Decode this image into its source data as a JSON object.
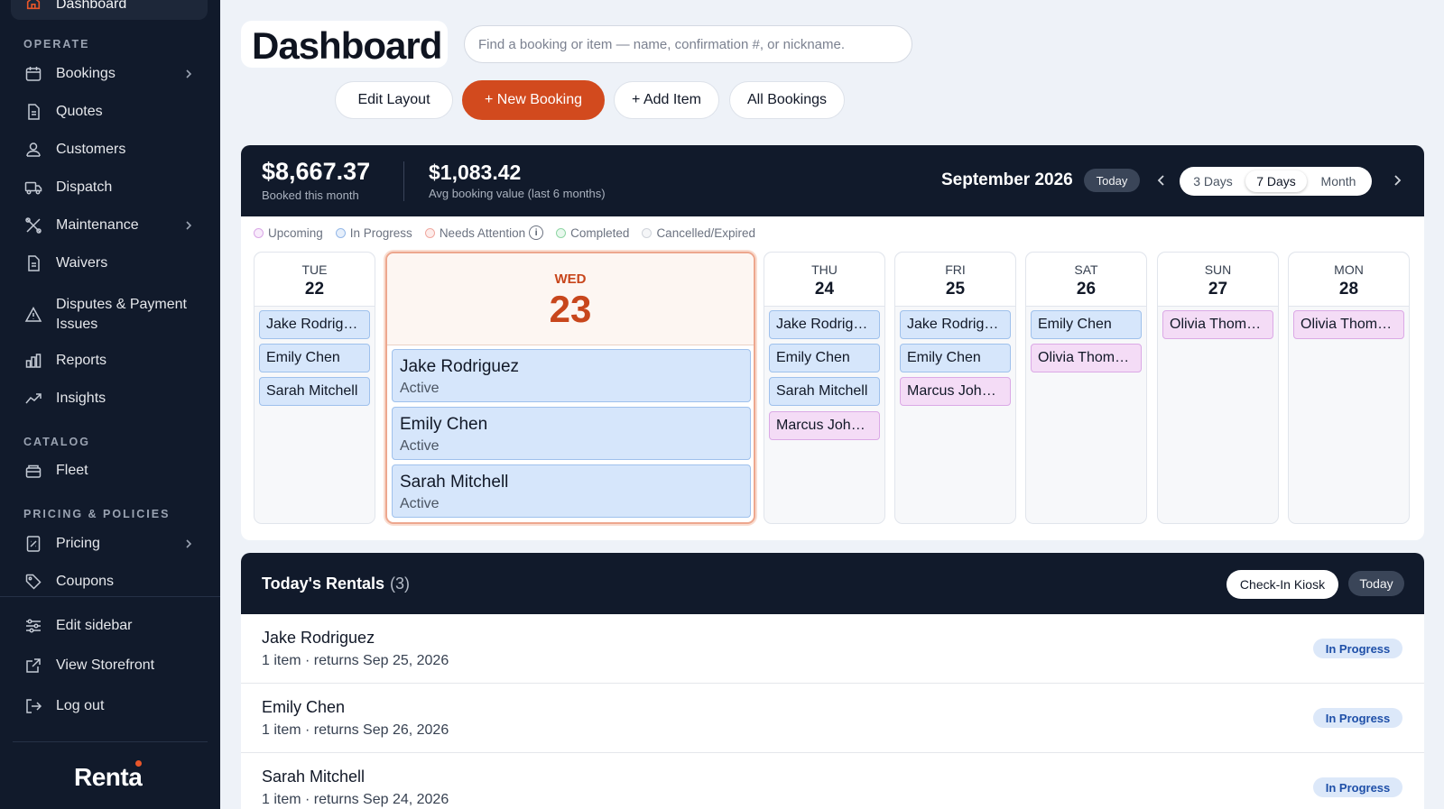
{
  "sidebar": {
    "active_label": "Dashboard",
    "sections": {
      "operate": "OPERATE",
      "catalog": "CATALOG",
      "pricing": "PRICING & POLICIES"
    },
    "items": {
      "bookings": "Bookings",
      "quotes": "Quotes",
      "customers": "Customers",
      "dispatch": "Dispatch",
      "maintenance": "Maintenance",
      "waivers": "Waivers",
      "disputes": "Disputes & Payment Issues",
      "reports": "Reports",
      "insights": "Insights",
      "fleet": "Fleet",
      "pricing": "Pricing",
      "coupons": "Coupons",
      "edit_sidebar": "Edit sidebar",
      "view_storefront": "View Storefront",
      "log_out": "Log out"
    },
    "logo": "Renta"
  },
  "header": {
    "title": "Dashboard",
    "search_placeholder": "Find a booking or item — name, confirmation #, or nickname.",
    "buttons": {
      "edit_layout": "Edit Layout",
      "new_booking": "+ New Booking",
      "add_item": "+ Add Item",
      "all_bookings": "All Bookings"
    }
  },
  "calendar": {
    "stat1": {
      "value": "$8,667.37",
      "label": "Booked this month"
    },
    "stat2": {
      "value": "$1,083.42",
      "label": "Avg booking value (last 6 months)"
    },
    "month": "September 2026",
    "today": "Today",
    "views": {
      "three": "3 Days",
      "seven": "7 Days",
      "month": "Month"
    },
    "legend": {
      "upcoming": "Upcoming",
      "in_progress": "In Progress",
      "needs_attention": "Needs Attention",
      "completed": "Completed",
      "cancelled": "Cancelled/Expired"
    },
    "days": {
      "tue": {
        "dow": "TUE",
        "num": "22",
        "b1": "Jake Rodriguez",
        "b2": "Emily Chen",
        "b3": "Sarah Mitchell"
      },
      "wed": {
        "dow": "WED",
        "num": "23",
        "b1": "Jake Rodriguez",
        "b2": "Emily Chen",
        "b3": "Sarah Mitchell",
        "status": "Active"
      },
      "thu": {
        "dow": "THU",
        "num": "24",
        "b1": "Jake Rodriguez",
        "b2": "Emily Chen",
        "b3": "Sarah Mitchell",
        "b4": "Marcus Johnson"
      },
      "fri": {
        "dow": "FRI",
        "num": "25",
        "b1": "Jake Rodriguez",
        "b2": "Emily Chen",
        "b3": "Marcus Johnson"
      },
      "sat": {
        "dow": "SAT",
        "num": "26",
        "b1": "Emily Chen",
        "b2": "Olivia Thompson"
      },
      "sun": {
        "dow": "SUN",
        "num": "27",
        "b1": "Olivia Thompson"
      },
      "mon": {
        "dow": "MON",
        "num": "28",
        "b1": "Olivia Thompson"
      }
    }
  },
  "rentals": {
    "title": "Today's Rentals",
    "count": "(3)",
    "kiosk": "Check-In Kiosk",
    "today": "Today",
    "rows": [
      {
        "name": "Jake Rodriguez",
        "sub": "1 item · returns Sep 25, 2026",
        "status": "In Progress"
      },
      {
        "name": "Emily Chen",
        "sub": "1 item · returns Sep 26, 2026",
        "status": "In Progress"
      },
      {
        "name": "Sarah Mitchell",
        "sub": "1 item · returns Sep 24, 2026",
        "status": "In Progress"
      }
    ]
  },
  "colors": {
    "accent": "#d24a1e",
    "sidebar_bg": "#111a2b",
    "chip_blue": "#d6e6fb",
    "chip_pink": "#f4dcf6",
    "legend_upcoming": "#d9a6e6",
    "legend_in_progress": "#94b8e8",
    "legend_needs_attention": "#f0a8a0",
    "legend_completed": "#8fd6a4",
    "legend_cancelled": "#cfd3da"
  }
}
